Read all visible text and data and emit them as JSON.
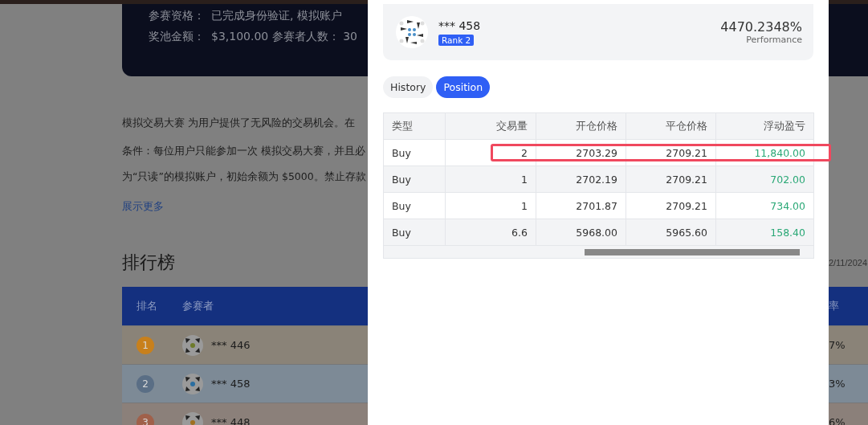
{
  "banner": {
    "lines": [
      {
        "label": "参赛资格：",
        "value": "已完成身份验证, 模拟账户"
      },
      {
        "label": "奖池金额：",
        "value": "$3,100.00 参赛者人数： 30"
      }
    ]
  },
  "intro": "模拟交易大赛 为用户提供了无风险的交易机会。在",
  "conditions": [
    "条件：每位用户只能参加一次 模拟交易大赛，并且必",
    "为“只读”的模拟账户，初始余额为 $5000。禁止存款"
  ],
  "show_more": "展示更多",
  "leaderboard": {
    "title": "排行榜",
    "date": "2/11/2024",
    "columns": [
      "排名",
      "参赛者",
      "率"
    ],
    "rows": [
      {
        "rank": "1",
        "color": "#c8801c",
        "name": "*** 446",
        "value": "7%"
      },
      {
        "rank": "2",
        "color": "#5a6e85",
        "name": "*** 458",
        "value": "3%"
      },
      {
        "rank": "3",
        "color": "#a0604a",
        "name": "*** 448",
        "value": "6%"
      }
    ]
  },
  "modal": {
    "user": {
      "name": "*** 458",
      "badge": "Rank 2",
      "performance": "4470.2348%",
      "performance_label": "Performance"
    },
    "tabs": [
      {
        "label": "History",
        "selected": false
      },
      {
        "label": "Position",
        "selected": true
      }
    ],
    "table": {
      "columns": [
        "类型",
        "交易量",
        "开仓价格",
        "平仓价格",
        "浮动盈亏"
      ],
      "rows": [
        {
          "cells": [
            "Buy",
            "2",
            "2703.29",
            "2709.21",
            "11,840.00"
          ],
          "highlighted": true
        },
        {
          "cells": [
            "Buy",
            "1",
            "2702.19",
            "2709.21",
            "702.00"
          ],
          "highlighted": false
        },
        {
          "cells": [
            "Buy",
            "1",
            "2701.87",
            "2709.21",
            "734.00"
          ],
          "highlighted": false
        },
        {
          "cells": [
            "Buy",
            "6.6",
            "5968.00",
            "5965.60",
            "158.40"
          ],
          "highlighted": false
        }
      ]
    }
  }
}
